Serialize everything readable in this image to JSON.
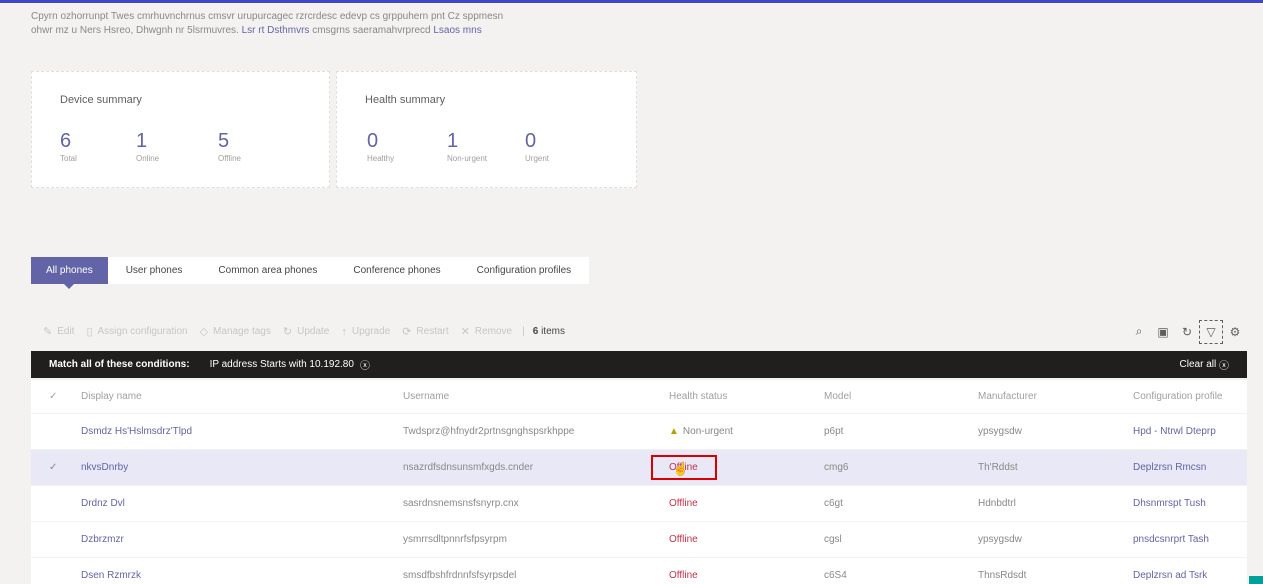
{
  "intro": {
    "line1": "Cpyrn ozhorrunpt Twes cmrhuvnchrnus cmsvr urupurcagec rzrcrdesc edevp cs grppuhern pnt Cz sppmesn",
    "line2": "ohwr mz u Ners Hsreo, Dhwgnh nr 5lsrmuvres. ",
    "link1": "Lsr rt Dsthmvrs",
    "line2b": " cmsgrns saeramahvrprecd ",
    "link2": "Lsaos mns"
  },
  "device_summary": {
    "title": "Device summary",
    "stats": [
      {
        "value": "6",
        "label": "Total"
      },
      {
        "value": "1",
        "label": "Online"
      },
      {
        "value": "5",
        "label": "Offline"
      }
    ]
  },
  "health_summary": {
    "title": "Health summary",
    "stats": [
      {
        "value": "0",
        "label": "Healthy"
      },
      {
        "value": "1",
        "label": "Non-urgent"
      },
      {
        "value": "0",
        "label": "Urgent"
      }
    ]
  },
  "tabs": [
    {
      "label": "All phones",
      "active": true
    },
    {
      "label": "User phones",
      "active": false
    },
    {
      "label": "Common area phones",
      "active": false
    },
    {
      "label": "Conference phones",
      "active": false
    },
    {
      "label": "Configuration profiles",
      "active": false
    }
  ],
  "toolbar": {
    "edit": "Edit",
    "assign": "Assign configuration",
    "manage_tags": "Manage tags",
    "update": "Update",
    "upgrade": "Upgrade",
    "restart": "Restart",
    "remove": "Remove",
    "count_num": "6",
    "count_label": " items"
  },
  "filter": {
    "lead": "Match all of these conditions:",
    "condition": "IP address  Starts with  10.192.80",
    "clear": "Clear all"
  },
  "table": {
    "headers": [
      "Display name",
      "Username",
      "Health status",
      "Model",
      "Manufacturer",
      "Configuration profile"
    ],
    "rows": [
      {
        "name": "Dsmdz Hs'Hslmsdrz'Tlpd",
        "user": "Twdsprz@hfnydr2prtnsgnghspsrkhppe",
        "status": "Non-urgent",
        "status_kind": "warn",
        "model": "p6pt",
        "mfr": "ypsygsdw",
        "profile": "Hpd - Ntrwl Dteprp"
      },
      {
        "name": "nkvsDnrby",
        "user": "nsazrdfsdnsunsmfxgds.cnder",
        "status": "Offline",
        "status_kind": "off",
        "model": "cmg6",
        "mfr": "Th'Rddst",
        "profile": "Deplzrsn Rmcsn",
        "highlight": true,
        "selected": true
      },
      {
        "name": "Drdnz Dvl",
        "user": "sasrdnsnemsnsfsnyrp.cnx",
        "status": "Offline",
        "status_kind": "off",
        "model": "c6gt",
        "mfr": "Hdnbdtrl",
        "profile": "Dhsnmrspt Tush"
      },
      {
        "name": "Dzbrzmzr",
        "user": "ysmrrsdltpnnrfsfpsyrpm",
        "status": "Offline",
        "status_kind": "off",
        "model": "cgsl",
        "mfr": "ypsygsdw",
        "profile": "pnsdcsnrprt Tash"
      },
      {
        "name": "Dsen Rzmrzk",
        "user": "smsdfbshfrdnnfsfsyrpsdel",
        "status": "Offline",
        "status_kind": "off",
        "model": "c6S4",
        "mfr": "ThnsRdsdt",
        "profile": "Deplzrsn ad Tsrk"
      }
    ]
  },
  "colors": {
    "accent": "#6264a7",
    "filterbar": "#201f1e",
    "offline": "#c4314b",
    "highlight_box": "#dd0000"
  }
}
